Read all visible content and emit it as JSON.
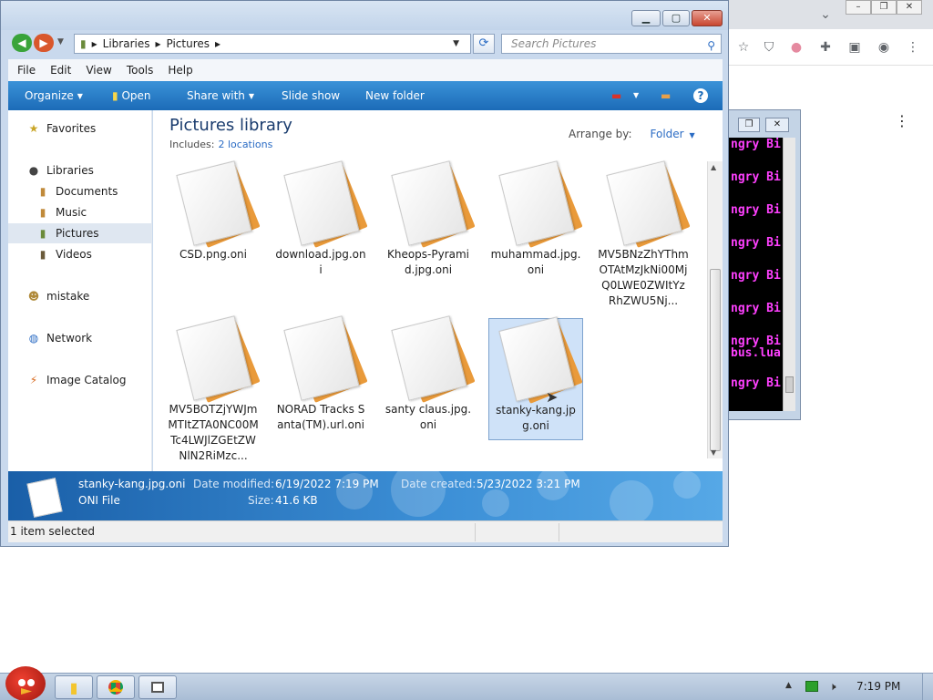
{
  "explorer": {
    "address_parts": [
      "Libraries",
      "Pictures"
    ],
    "search_placeholder": "Search Pictures",
    "menu": [
      "File",
      "Edit",
      "View",
      "Tools",
      "Help"
    ],
    "commands": {
      "organize": "Organize",
      "open": "Open",
      "share_with": "Share with",
      "slide_show": "Slide show",
      "new_folder": "New folder"
    },
    "nav": {
      "favorites": "Favorites",
      "libraries": "Libraries",
      "documents": "Documents",
      "music": "Music",
      "pictures": "Pictures",
      "videos": "Videos",
      "mistake": "mistake",
      "network": "Network",
      "image_catalog": "Image Catalog"
    },
    "library": {
      "title": "Pictures library",
      "includes_label": "Includes:",
      "locations": "2 locations",
      "arrange_label": "Arrange by:",
      "arrange_value": "Folder"
    },
    "files": [
      "CSD.png.oni",
      "download.jpg.oni",
      "Kheops-Pyramid.jpg.oni",
      "muhammad.jpg.oni",
      "MV5BNzZhYThmOTAtMzJkNi00MjQ0LWE0ZWItYzRhZWU5Nj...",
      "MV5BOTZjYWJmMTItZTA0NC00MTc4LWJlZGEtZWNlN2RiMzc...",
      "NORAD Tracks Santa(TM).url.oni",
      "santy claus.jpg.oni",
      "stanky-kang.jpg.oni"
    ],
    "details": {
      "name": "stanky-kang.jpg.oni",
      "type": "ONI File",
      "modified_label": "Date modified:",
      "modified_value": "6/19/2022 7:19 PM",
      "size_label": "Size:",
      "size_value": "41.6 KB",
      "created_label": "Date created:",
      "created_value": "5/23/2022 3:21 PM"
    },
    "status": "1 item selected"
  },
  "console": {
    "lines": [
      "ngry Bi",
      "ngry Bi",
      "ngry Bi",
      "ngry Bi",
      "ngry Bi",
      "ngry Bi",
      "ngry Bi",
      "bus.lua",
      "ngry Bi"
    ]
  },
  "taskbar": {
    "clock": "7:19 PM"
  },
  "colors": {
    "accent": "#2b6cc4",
    "command_bar": "#1c6bb8",
    "console_text": "#ff40ff"
  }
}
